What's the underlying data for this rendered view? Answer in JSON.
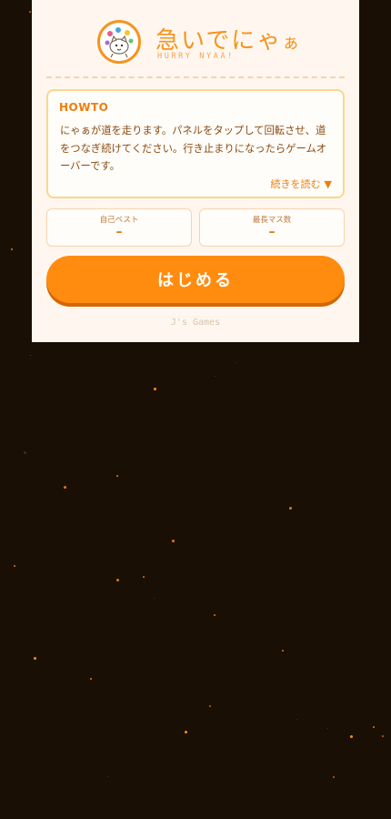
{
  "app": {
    "title_main": "急いでにゃ",
    "title_small": "ぁ",
    "subtitle": "HURRY NYAA!",
    "logo": "cat-logo-icon"
  },
  "howto": {
    "title": "HOWTO",
    "text": "にゃぁが道を走ります。パネルをタップして回転させ、道をつなぎ続けてください。行き止まりになったらゲームオーバーです。",
    "read_more": "続きを読む",
    "read_more_icon": "▼"
  },
  "stats": {
    "best": {
      "label": "自己ベスト",
      "value": "–"
    },
    "max_cells": {
      "label": "最長マス数",
      "value": "–"
    }
  },
  "start_button": "はじめる",
  "footer": "J's Games",
  "colors": {
    "background": "#1a0f05",
    "panel": "#fff7ef",
    "accent": "#ff8c0f",
    "text": "#8a4a13"
  }
}
